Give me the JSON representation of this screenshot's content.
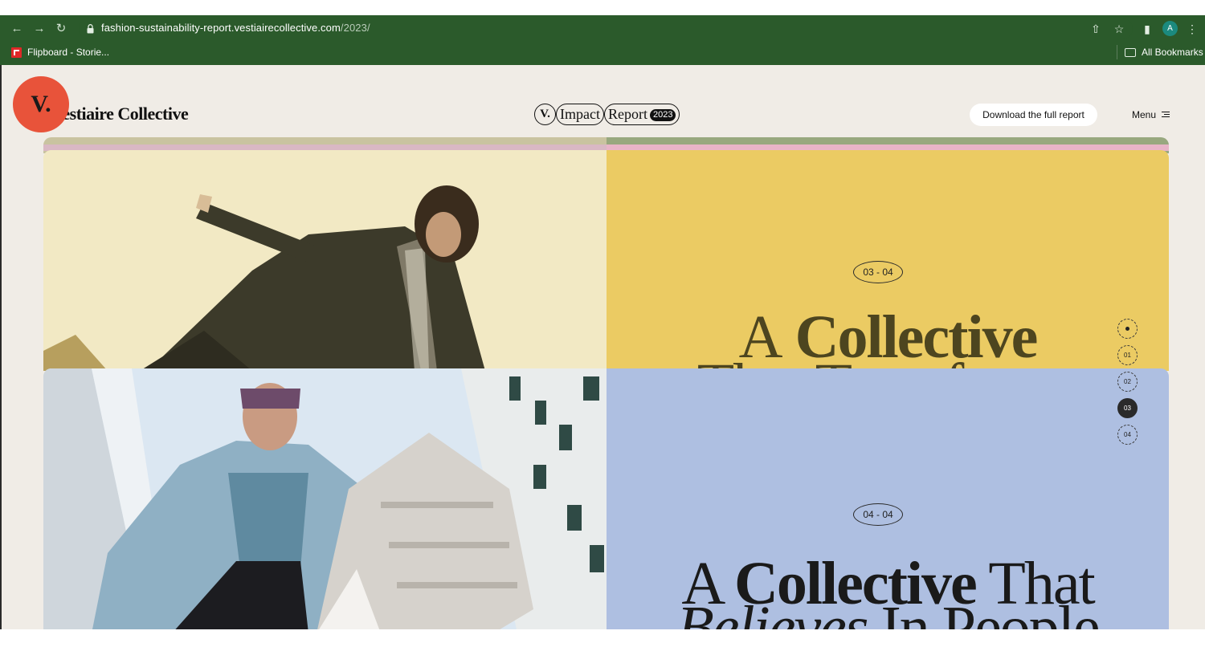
{
  "browser": {
    "url_host": "fashion-sustainability-report.vestiairecollective.com",
    "url_path": "/2023/",
    "bookmark": "Flipboard - Storie...",
    "all_bookmarks": "All Bookmarks",
    "profile_initial": "A"
  },
  "header": {
    "logo_mark": "V.",
    "wordmark": "Vestiaire Collective",
    "badge_v": "V.",
    "badge_impact": "Impact",
    "badge_report": "Report",
    "badge_year": "2023",
    "download_label": "Download the full report",
    "menu_label": "Menu"
  },
  "chapter3": {
    "counter": "03 - 04",
    "title_line1_a": "A",
    "title_line1_b": "Collective",
    "title_line2": "That Transforms"
  },
  "chapter4": {
    "counter": "04 - 04",
    "title_line1_a": "A",
    "title_line1_b": "Collective",
    "title_line1_c": "That",
    "title_line2_a": "Believes",
    "title_line2_b": "In People"
  },
  "progress_nav": {
    "items": [
      "01",
      "02",
      "03",
      "04"
    ],
    "active_index": 2
  },
  "colors": {
    "chrome": "#2b5a2b",
    "logo": "#e8533a",
    "chapter3_panel": "#ebcb63",
    "chapter4_panel": "#aebfe1"
  }
}
